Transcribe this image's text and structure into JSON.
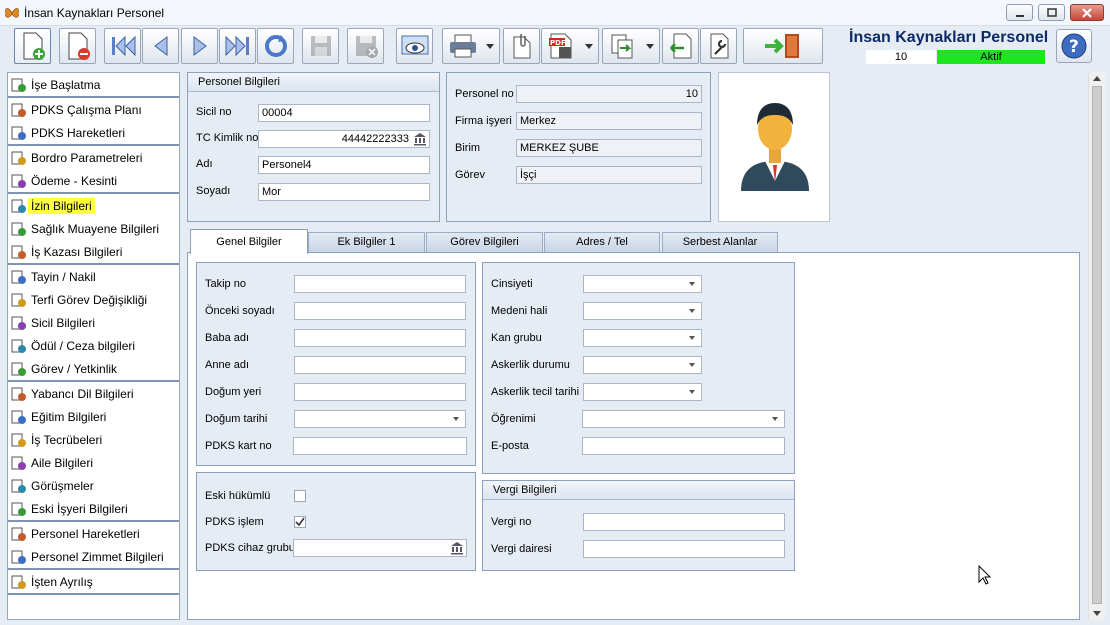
{
  "window": {
    "title": "İnsan Kaynakları Personel"
  },
  "header": {
    "app_title": "İnsan Kaynakları Personel",
    "record_number": "10",
    "record_status": "Aktif"
  },
  "colors": {
    "status_active": "#1ee61e",
    "selected_highlight": "#ffff46",
    "heading": "#0d2a66"
  },
  "toolbar": {
    "icons": [
      "new-record-icon",
      "delete-record-icon",
      "first-record-icon",
      "previous-record-icon",
      "next-record-icon",
      "last-record-icon",
      "refresh-icon",
      "save-icon",
      "cancel-save-icon",
      "preview-icon",
      "print-icon",
      "attach-icon",
      "pdf-export-icon",
      "export-icon",
      "import-icon",
      "settings-wrench-icon",
      "exit-icon",
      "help-icon"
    ]
  },
  "sidebar": {
    "groups": [
      [
        {
          "label": "İşe Başlatma",
          "icon": "flag-icon"
        }
      ],
      [
        {
          "label": "PDKS Çalışma Planı",
          "icon": "schedule-icon"
        },
        {
          "label": "PDKS Hareketleri",
          "icon": "schedule-icon"
        }
      ],
      [
        {
          "label": "Bordro Parametreleri",
          "icon": "payroll-icon"
        },
        {
          "label": "Ödeme - Kesinti",
          "icon": "money-icon"
        }
      ],
      [
        {
          "label": "İzin Bilgileri",
          "icon": "leave-icon"
        },
        {
          "label": "Sağlık Muayene Bilgileri",
          "icon": "health-icon"
        },
        {
          "label": "İş Kazası Bilgileri",
          "icon": "accident-icon"
        }
      ],
      [
        {
          "label": "Tayin / Nakil",
          "icon": "transfer-icon"
        },
        {
          "label": "Terfi Görev Değişikliği",
          "icon": "promotion-icon"
        },
        {
          "label": "Sicil Bilgileri",
          "icon": "record-icon"
        },
        {
          "label": "Ödül / Ceza bilgileri",
          "icon": "award-icon"
        },
        {
          "label": "Görev / Yetkinlik",
          "icon": "task-icon"
        }
      ],
      [
        {
          "label": "Yabancı Dil Bilgileri",
          "icon": "language-icon"
        },
        {
          "label": "Eğitim Bilgileri",
          "icon": "education-icon"
        },
        {
          "label": "İş Tecrübeleri",
          "icon": "experience-icon"
        },
        {
          "label": "Aile Bilgileri",
          "icon": "family-icon"
        },
        {
          "label": "Görüşmeler",
          "icon": "meeting-icon"
        },
        {
          "label": "Eski İşyeri Bilgileri",
          "icon": "info-icon"
        }
      ],
      [
        {
          "label": "Personel Hareketleri",
          "icon": "movement-icon"
        },
        {
          "label": "Personel Zimmet Bilgileri",
          "icon": "asset-icon"
        }
      ],
      [
        {
          "label": "İşten Ayrılış",
          "icon": "leave-job-icon"
        }
      ]
    ],
    "selected": "İzin Bilgileri"
  },
  "personel": {
    "header": "Personel Bilgileri",
    "sicil_label": "Sicil no",
    "sicil": "00004",
    "tc_label": "TC Kimlik no",
    "tc": "44442222333",
    "ad_label": "Adı",
    "ad": "Personel4",
    "soyad_label": "Soyadı",
    "soyad": "Mor"
  },
  "firma": {
    "personel_no_label": "Personel no",
    "personel_no": "10",
    "firma_label": "Firma işyeri",
    "firma": "Merkez",
    "birim_label": "Birim",
    "birim": "MERKEZ ŞUBE",
    "gorev_label": "Görev",
    "gorev": "İşçi"
  },
  "tabs": [
    "Genel Bilgiler",
    "Ek Bilgiler 1",
    "Görev Bilgileri",
    "Adres / Tel",
    "Serbest Alanlar"
  ],
  "genel": {
    "left": [
      "Takip no",
      "Önceki soyadı",
      "Baba adı",
      "Anne adı",
      "Doğum yeri",
      "Doğum tarihi",
      "PDKS kart no"
    ],
    "right": [
      "Cinsiyeti",
      "Medeni hali",
      "Kan grubu",
      "Askerlik durumu",
      "Askerlik tecil tarihi",
      "Öğrenimi",
      "E-posta"
    ],
    "eski_hukumlu_label": "Eski hükümlü",
    "eski_hukumlu": false,
    "pdks_islem_label": "PDKS işlem",
    "pdks_islem": true,
    "pdks_cihaz_label": "PDKS cihaz grubu",
    "vergi_header": "Vergi Bilgileri",
    "vergi_no_label": "Vergi no",
    "vergi_dairesi_label": "Vergi dairesi"
  }
}
